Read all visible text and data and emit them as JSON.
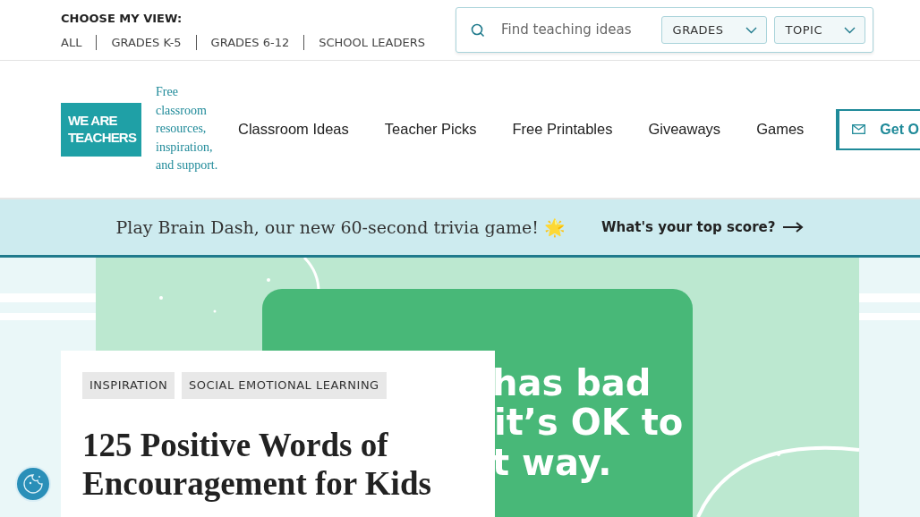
{
  "view_chooser": {
    "label": "CHOOSE MY VIEW:",
    "options": [
      {
        "label": "ALL",
        "selected": false
      },
      {
        "label": "GRADES K-5",
        "selected": false
      },
      {
        "label": "GRADES 6-12",
        "selected": false
      },
      {
        "label": "SCHOOL LEADERS",
        "selected": false
      }
    ]
  },
  "search": {
    "placeholder": "Find teaching ideas",
    "filters": [
      "GRADES",
      "TOPIC"
    ]
  },
  "logo": {
    "lines": [
      "WE ARE",
      "TEACHERS"
    ],
    "tagline": "Free classroom resources, inspiration, and support."
  },
  "nav": [
    "Classroom Ideas",
    "Teacher Picks",
    "Free Printables",
    "Giveaways",
    "Games"
  ],
  "newsletter_button": "Get O",
  "banner": {
    "text": "Play Brain Dash, our new 60-second trivia game! 🌟",
    "link": "What's your top score?"
  },
  "hero_image": {
    "lines": [
      "has bad",
      "it’s OK to",
      "t way."
    ]
  },
  "article": {
    "tags": [
      "INSPIRATION",
      "SOCIAL EMOTIONAL LEARNING"
    ],
    "title": "125 Positive Words of Encouragement for Kids"
  }
}
